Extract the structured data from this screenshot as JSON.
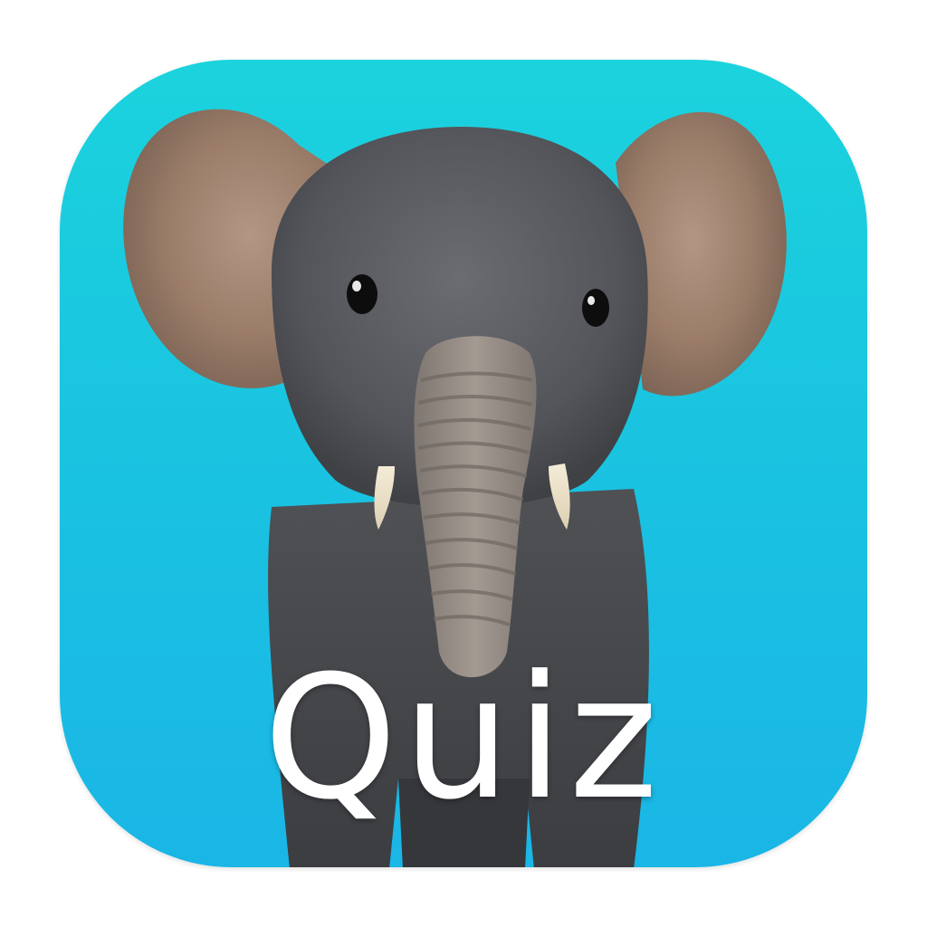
{
  "app_icon": {
    "label": "Quiz",
    "subject_icon": "baby-elephant-icon",
    "colors": {
      "background_top": "#1bd3dd",
      "background_bottom": "#1ab6e6",
      "label": "#ffffff",
      "elephant_body": "#55575a",
      "elephant_ear": "#a48570"
    }
  }
}
